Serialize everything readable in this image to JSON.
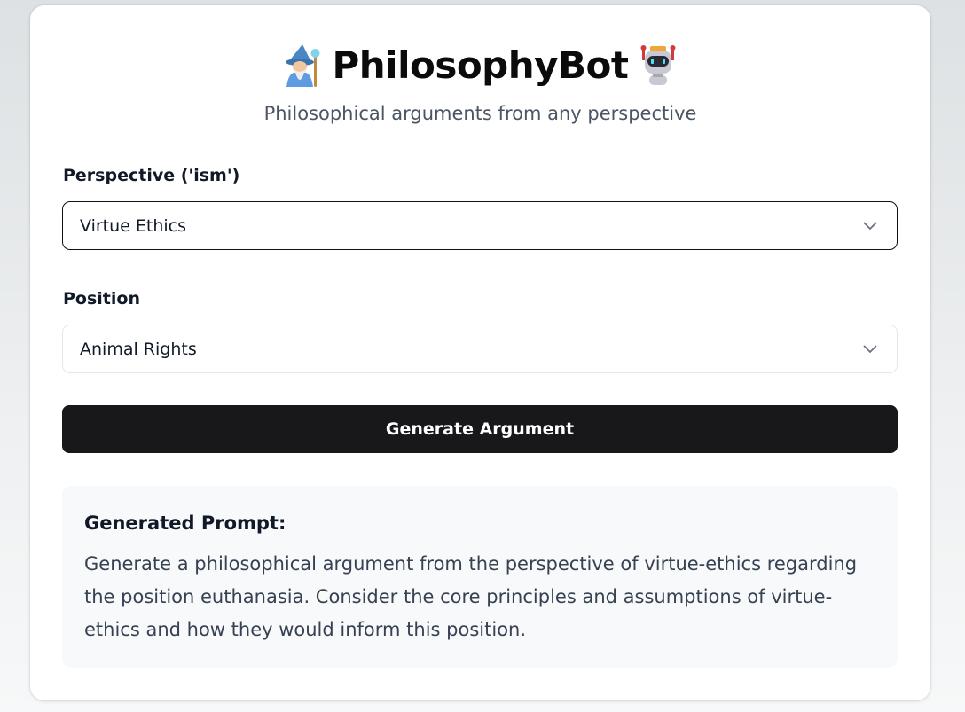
{
  "header": {
    "title": "PhilosophyBot",
    "subtitle": "Philosophical arguments from any perspective",
    "left_icon": "wizard-emoji",
    "right_icon": "robot-emoji"
  },
  "form": {
    "perspective": {
      "label": "Perspective ('ism')",
      "value": "Virtue Ethics"
    },
    "position": {
      "label": "Position",
      "value": "Animal Rights"
    },
    "generate_button": "Generate Argument"
  },
  "result": {
    "title": "Generated Prompt:",
    "text": "Generate a philosophical argument from the perspective of virtue-ethics regarding the position euthanasia. Consider the core principles and assumptions of virtue-ethics and how they would inform this position."
  },
  "colors": {
    "button_bg": "#18181a",
    "panel_bg": "#f8f9fb",
    "subtitle": "#4b5563"
  }
}
